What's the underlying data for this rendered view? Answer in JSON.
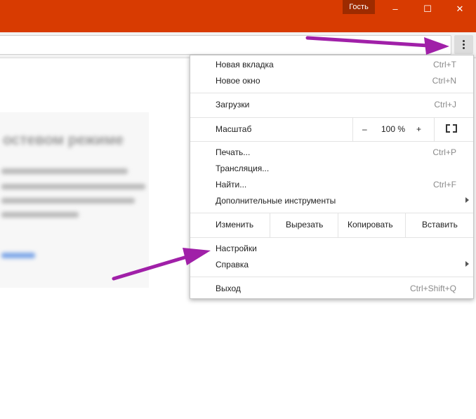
{
  "titlebar": {
    "guest_label": "Гость",
    "minimize": "–",
    "maximize": "☐",
    "close": "✕"
  },
  "menu_button": {
    "icon": "three-dots-vertical-icon"
  },
  "menu": {
    "new_tab": {
      "label": "Новая вкладка",
      "shortcut": "Ctrl+T"
    },
    "new_window": {
      "label": "Новое окно",
      "shortcut": "Ctrl+N"
    },
    "downloads": {
      "label": "Загрузки",
      "shortcut": "Ctrl+J"
    },
    "zoom": {
      "label": "Масштаб",
      "minus": "–",
      "value": "100 %",
      "plus": "+",
      "fullscreen_icon": "fullscreen-icon"
    },
    "print": {
      "label": "Печать...",
      "shortcut": "Ctrl+P"
    },
    "cast": {
      "label": "Трансляция..."
    },
    "find": {
      "label": "Найти...",
      "shortcut": "Ctrl+F"
    },
    "more_tools": {
      "label": "Дополнительные инструменты"
    },
    "edit": {
      "label": "Изменить",
      "cut": "Вырезать",
      "copy": "Копировать",
      "paste": "Вставить"
    },
    "settings": {
      "label": "Настройки"
    },
    "help": {
      "label": "Справка"
    },
    "exit": {
      "label": "Выход",
      "shortcut": "Ctrl+Shift+Q"
    }
  },
  "background_page": {
    "heading": "остевом режиме"
  },
  "colors": {
    "titlebar": "#d83b01",
    "annotation_arrow": "#a020a8"
  }
}
